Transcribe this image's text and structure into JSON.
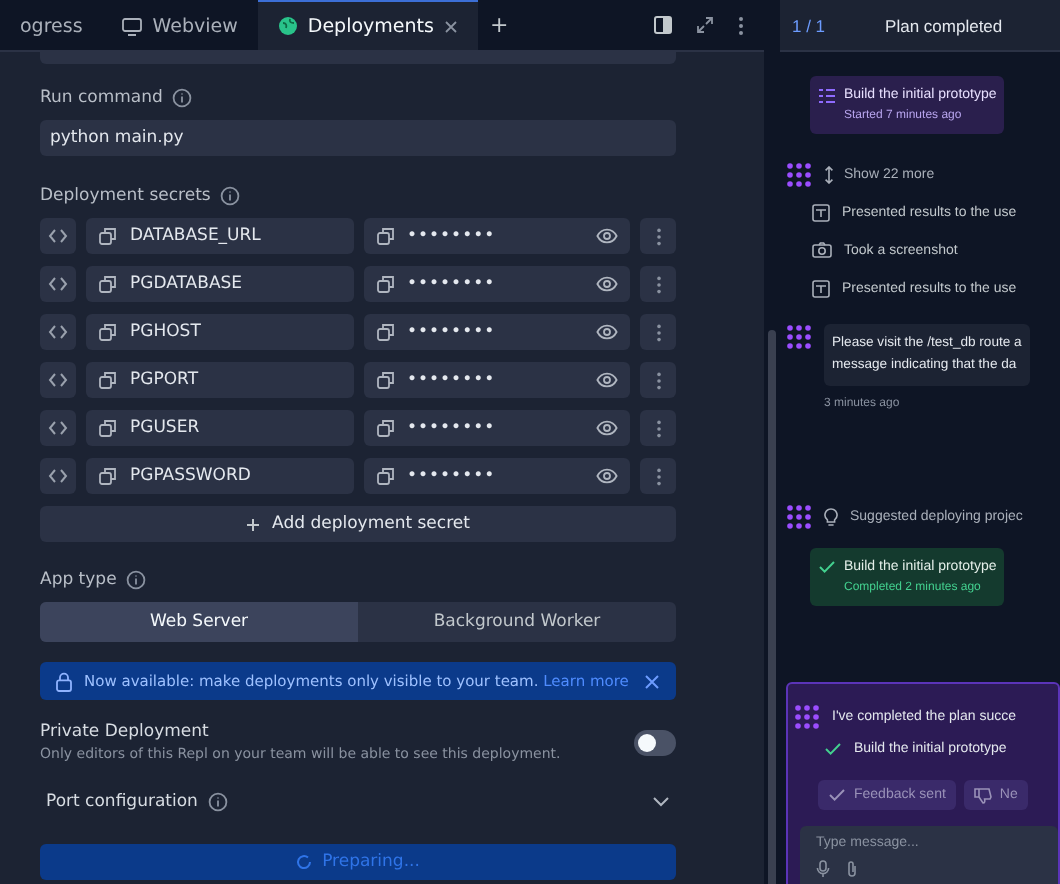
{
  "tabs": [
    {
      "label": "ogress",
      "kind": "plain",
      "selected": false
    },
    {
      "label": "Webview",
      "kind": "webview",
      "selected": false
    },
    {
      "label": "Deployments",
      "kind": "deploy",
      "selected": true
    }
  ],
  "new_tab": "+",
  "deploy": {
    "run_command": {
      "label": "Run command",
      "value": "python main.py"
    },
    "secrets_label": "Deployment secrets",
    "secrets": [
      {
        "name": "DATABASE_URL",
        "value": "••••••••"
      },
      {
        "name": "PGDATABASE",
        "value": "••••••••"
      },
      {
        "name": "PGHOST",
        "value": "••••••••"
      },
      {
        "name": "PGPORT",
        "value": "••••••••"
      },
      {
        "name": "PGUSER",
        "value": "••••••••"
      },
      {
        "name": "PGPASSWORD",
        "value": "••••••••"
      }
    ],
    "add_secret": "Add deployment secret",
    "app_type_label": "App type",
    "app_types": [
      {
        "label": "Web Server",
        "selected": true
      },
      {
        "label": "Background Worker",
        "selected": false
      }
    ],
    "banner": {
      "text": "Now available: make deployments only visible to your team.",
      "link": "Learn more"
    },
    "private": {
      "title": "Private Deployment",
      "description": "Only editors of this Repl on your team will be able to see this deployment.",
      "on": false
    },
    "port_config": {
      "label": "Port configuration",
      "expanded": false
    },
    "submit": "Preparing..."
  },
  "agent": {
    "counter": "1 / 1",
    "title": "Plan completed",
    "plan_started": {
      "title": "Build the initial prototype",
      "time": "Started 7 minutes ago"
    },
    "show_more": "Show 22 more",
    "actions": [
      {
        "kind": "present",
        "text": "Presented results to the use"
      },
      {
        "kind": "screenshot",
        "text": "Took a screenshot"
      },
      {
        "kind": "present",
        "text": "Presented results to the use"
      }
    ],
    "message": {
      "lines": [
        "Please visit the /test_db route a",
        "message indicating that the da"
      ],
      "time": "3 minutes ago"
    },
    "suggestion": "Suggested deploying projec",
    "plan_done": {
      "title": "Build the initial prototype",
      "time": "Completed 2 minutes ago"
    },
    "final": {
      "text": "I've completed the plan succe",
      "item": "Build the initial prototype",
      "feedback": "Feedback sent",
      "second": "Ne"
    },
    "input": {
      "placeholder": "Type message..."
    }
  }
}
